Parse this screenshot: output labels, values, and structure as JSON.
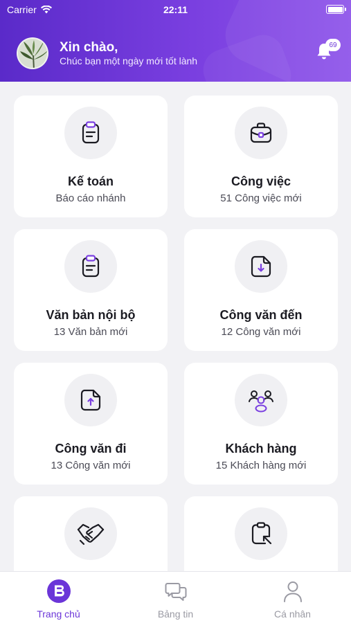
{
  "status_bar": {
    "carrier": "Carrier",
    "time": "22:11"
  },
  "header": {
    "greeting": "Xin chào,",
    "subtitle": "Chúc bạn một ngày mới tốt lành",
    "notification_count": "69"
  },
  "colors": {
    "accent": "#6b35d8",
    "header_start": "#5a2ac9",
    "header_end": "#8f55ea",
    "background": "#f2f2f5"
  },
  "cards": [
    {
      "title": "Kế toán",
      "subtitle": "Báo cáo nhánh",
      "icon": "clipboard-icon"
    },
    {
      "title": "Công việc",
      "subtitle": "51 Công việc mới",
      "icon": "briefcase-icon"
    },
    {
      "title": "Văn bản nội bộ",
      "subtitle": "13 Văn bản mới",
      "icon": "clipboard-icon"
    },
    {
      "title": "Công văn đến",
      "subtitle": "12 Công văn mới",
      "icon": "document-download-icon"
    },
    {
      "title": "Công văn đi",
      "subtitle": "13 Công văn mới",
      "icon": "document-upload-icon"
    },
    {
      "title": "Khách hàng",
      "subtitle": "15 Khách hàng mới",
      "icon": "people-icon"
    },
    {
      "title": "",
      "subtitle": "",
      "icon": "handshake-icon"
    },
    {
      "title": "",
      "subtitle": "",
      "icon": "clipboard-arrow-icon"
    }
  ],
  "tabbar": {
    "items": [
      {
        "label": "Trang chủ",
        "icon": "home-logo-icon",
        "active": true
      },
      {
        "label": "Bảng tin",
        "icon": "chat-bubbles-icon",
        "active": false
      },
      {
        "label": "Cá nhân",
        "icon": "person-icon",
        "active": false
      }
    ]
  }
}
